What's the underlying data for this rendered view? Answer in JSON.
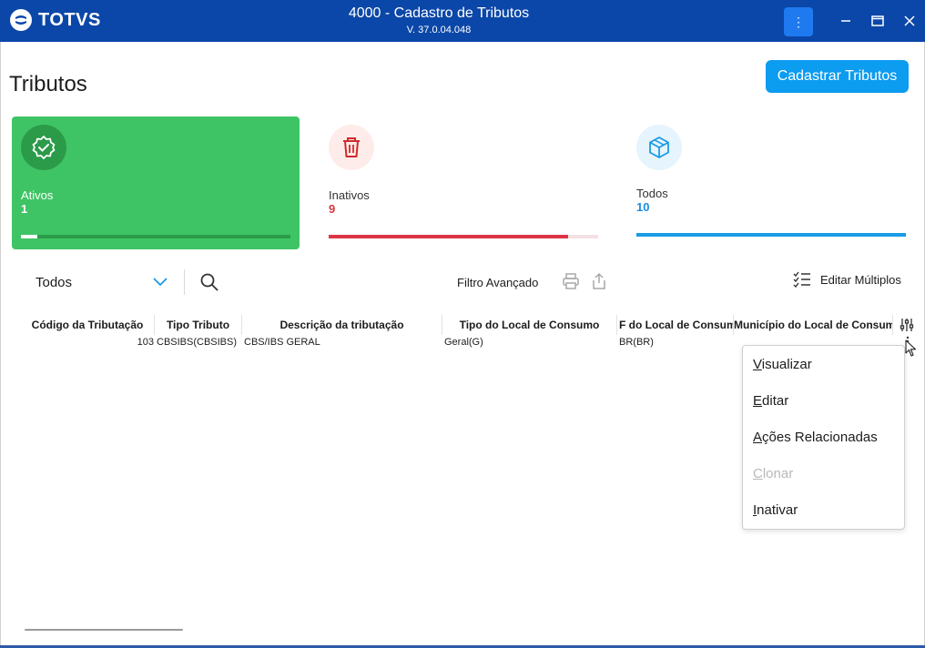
{
  "window": {
    "brand": "TOTVS",
    "title": "4000 - Cadastro de Tributos",
    "version": "V. 37.0.04.048"
  },
  "colors": {
    "titlebar": "#0b47a8",
    "accent": "#0c9cf0",
    "ativos": "#3ec464",
    "inativos": "#dc3545",
    "todos": "#1a9be6"
  },
  "page": {
    "title": "Tributos",
    "primary_button": "Cadastrar Tributos"
  },
  "cards": {
    "ativos": {
      "label": "Ativos",
      "count": "1",
      "icon": "verified-badge-icon",
      "progress": 0.06
    },
    "inativos": {
      "label": "Inativos",
      "count": "9",
      "icon": "trash-icon",
      "progress": 0.89
    },
    "todos": {
      "label": "Todos",
      "count": "10",
      "icon": "cube-icon",
      "progress": 1.0
    }
  },
  "toolbar": {
    "filter_value": "Todos",
    "advanced_filter": "Filtro Avançado",
    "edit_multiple": "Editar Múltiplos"
  },
  "table": {
    "columns": [
      "Código da Tributação",
      "Tipo Tributo",
      "Descrição da tributação",
      "Tipo do Local de Consumo",
      "F do Local de Consum",
      "Município do Local de Consumo"
    ],
    "rows": [
      [
        "103",
        "CBSIBS(CBSIBS)",
        "CBS/IBS GERAL",
        "Geral(G)",
        "BR(BR)",
        ""
      ]
    ]
  },
  "context_menu": {
    "items": [
      {
        "label": "Visualizar",
        "enabled": true
      },
      {
        "label": "Editar",
        "enabled": true
      },
      {
        "label": "Ações Relacionadas",
        "enabled": true
      },
      {
        "label": "Clonar",
        "enabled": false
      },
      {
        "label": "Inativar",
        "enabled": true
      }
    ]
  }
}
